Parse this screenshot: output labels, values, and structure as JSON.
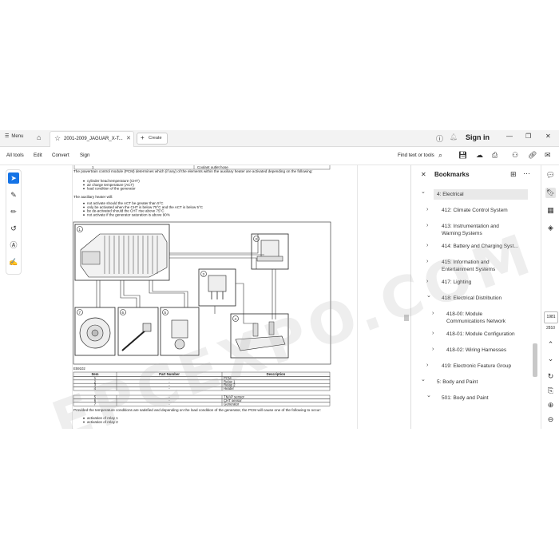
{
  "tabbar": {
    "menu_label": "Menu",
    "doc_tab_title": "2001-2009_JAGUAR_X-T...",
    "create_label": "Create",
    "signin_label": "Sign in"
  },
  "toolbar": {
    "all_tools": "All tools",
    "edit": "Edit",
    "convert": "Convert",
    "sign": "Sign",
    "find_text": "Find text or tools"
  },
  "document": {
    "row_top_left": "1",
    "row_top_right": "Coolant outlet hose",
    "para1": "The powertrain control module (PCM) determines which (if any) of the elements within the auxiliary heater are activated depending on the following:",
    "bullets1": [
      "cylinder head temperature (CHT)",
      "air charge temperature (ACT)",
      "load condition of the generator"
    ],
    "para2": "The auxiliary heater will:",
    "bullets2": [
      "not activate should the ACT be greater than 5°C",
      "only be activated when the CHT is below 75°C and the ACT is below 5°C",
      "be de-activated should the CHT rise above 75°C",
      "not activate if the generator saturation is above 90%"
    ],
    "fig_id": "E59102",
    "callouts": [
      "1",
      "2",
      "3",
      "4",
      "5",
      "6",
      "7"
    ],
    "table_headers": [
      "Item",
      "Part Number",
      "Description"
    ],
    "table_rows": [
      [
        "1",
        "-",
        "PCM"
      ],
      [
        "2",
        "-",
        "Relay 1"
      ],
      [
        "3",
        "-",
        "Relay 2"
      ],
      [
        "4",
        "-",
        "Heater"
      ]
    ],
    "table2_rows": [
      [
        "5",
        "-",
        "TMAP sensor"
      ],
      [
        "6",
        "-",
        "CHT sensor"
      ],
      [
        "7",
        "-",
        "Generator"
      ]
    ],
    "para3": "Provided the temperature conditions are satisfied and depending on the load condition of the generator, the PCM will cause one of the following to occur:",
    "bullets3": [
      "activation of relay 1",
      "activation of relay 2"
    ]
  },
  "bookmarks": {
    "title": "Bookmarks",
    "items": [
      {
        "label": "4: Electrical",
        "chev": "⌄"
      },
      {
        "label": "412: Climate Control System",
        "chev": "›"
      },
      {
        "label": "413: Instrumentation and",
        "label2": "Warning Systems",
        "chev": "›"
      },
      {
        "label": "414: Battery and Charging Syst...",
        "chev": "›"
      },
      {
        "label": "415: Information and",
        "label2": "Entertainment Systems",
        "chev": "›"
      },
      {
        "label": "417: Lighting",
        "chev": "›"
      },
      {
        "label": "418: Electrical Distribution",
        "chev": "⌄"
      },
      {
        "label": "418-00: Module",
        "label2": "Communications Network",
        "chev": "›"
      },
      {
        "label": "418-01: Module Configuration",
        "chev": "›"
      },
      {
        "label": "418-02: Wiring Harnesses",
        "chev": "›"
      },
      {
        "label": "419: Electronic Feature Group",
        "chev": "›"
      },
      {
        "label": "5: Body and Paint",
        "chev": "⌄"
      },
      {
        "label": "501: Body and Paint",
        "chev": "⌄"
      }
    ]
  },
  "pager": {
    "current": "1981",
    "total": "2810"
  },
  "watermark": "EPCEXPO.COM",
  "colors": {
    "accent": "#1473e6",
    "selected_bg": "#e9e9e9"
  }
}
